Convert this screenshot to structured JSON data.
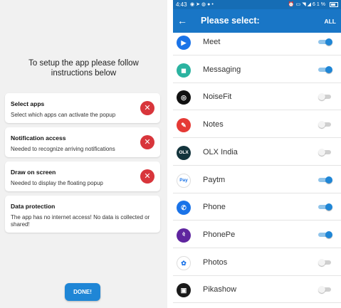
{
  "setup": {
    "intro_line1": "To setup the app please follow",
    "intro_line2": "instructions below",
    "cards": [
      {
        "title": "Select apps",
        "desc": "Select which apps can activate the popup",
        "status_icon": "close-icon"
      },
      {
        "title": "Notification access",
        "desc": "Needed to recognize arriving notifications",
        "status_icon": "close-icon"
      },
      {
        "title": "Draw on screen",
        "desc": "Needed to display the floating popup",
        "status_icon": "close-icon"
      },
      {
        "title": "Data protection",
        "desc": "The app has no internet access! No data is collected or shared!"
      }
    ],
    "done_label": "DONE!"
  },
  "status_bar": {
    "time": "4:43",
    "battery": "61%",
    "icons": [
      "whatsapp-icon",
      "telegram-icon",
      "messenger-icon",
      "signal-icon",
      "alarm-icon",
      "volte-icon",
      "wifi-icon",
      "cell-signal-icon",
      "battery-icon"
    ]
  },
  "toolbar": {
    "title": "Please select:",
    "all_label": "ALL"
  },
  "apps": [
    {
      "name": "Meet",
      "enabled": true,
      "icon_color": "#1a73e8"
    },
    {
      "name": "Messaging",
      "enabled": true,
      "icon_color": "#2bb3a0"
    },
    {
      "name": "NoiseFit",
      "enabled": false,
      "icon_color": "#111111"
    },
    {
      "name": "Notes",
      "enabled": false,
      "icon_color": "#e53935"
    },
    {
      "name": "OLX India",
      "enabled": false,
      "icon_color": "#13343c"
    },
    {
      "name": "Paytm",
      "enabled": true,
      "icon_color": "#ffffff"
    },
    {
      "name": "Phone",
      "enabled": true,
      "icon_color": "#1a73e8"
    },
    {
      "name": "PhonePe",
      "enabled": true,
      "icon_color": "#5f259f"
    },
    {
      "name": "Photos",
      "enabled": false,
      "icon_color": "#ffffff"
    },
    {
      "name": "Pikashow",
      "enabled": false,
      "icon_color": "#1a1a1a"
    }
  ],
  "colors": {
    "primary": "#1976c6",
    "status_bar": "#166db5",
    "error": "#d8353b",
    "toggle_on": "#1f86d6"
  }
}
